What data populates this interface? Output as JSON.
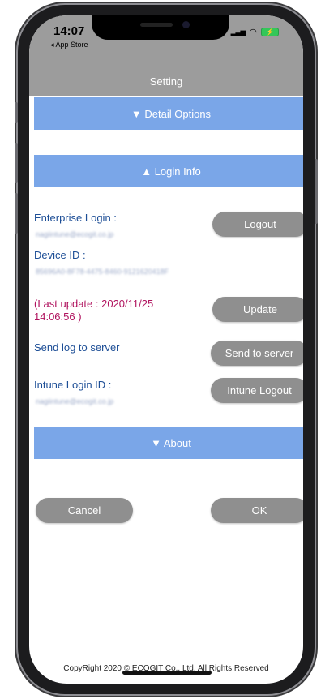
{
  "status_bar": {
    "time": "14:07",
    "back_app": "◂ App Store",
    "signal_glyph": "▂▃▅",
    "wifi_glyph": "◠",
    "battery_glyph": "⚡"
  },
  "header": {
    "title": "Setting"
  },
  "sections": {
    "detail_options": "▼ Detail Options",
    "login_info": "▲ Login Info",
    "about": "▼ About"
  },
  "login_info": {
    "enterprise_login_label": "Enterprise Login :",
    "enterprise_login_value": "nagiintune@ecogit.co.jp",
    "logout_button": "Logout",
    "device_id_label": "Device ID :",
    "device_id_value": "85696A0-8F78-4475-8460-9121620418F",
    "last_update_line1": "(Last update : 2020/11/25",
    "last_update_line2": "14:06:56 )",
    "update_button": "Update",
    "send_log_label": "Send log to server",
    "send_button": "Send to server",
    "intune_label": "Intune Login ID :",
    "intune_value": "nagiintune@ecogit.co.jp",
    "intune_logout_button": "Intune Logout"
  },
  "actions": {
    "cancel": "Cancel",
    "ok": "OK"
  },
  "footer": {
    "copyright": "CopyRight 2020 © ECOGIT Co., Ltd. All Rights Reserved"
  },
  "colors": {
    "header_bg": "#9c9c9c",
    "section_bar": "#7aa6e8",
    "label_text": "#1d4e96",
    "alert_text": "#b0125e",
    "button_bg": "#8f8f8f"
  }
}
